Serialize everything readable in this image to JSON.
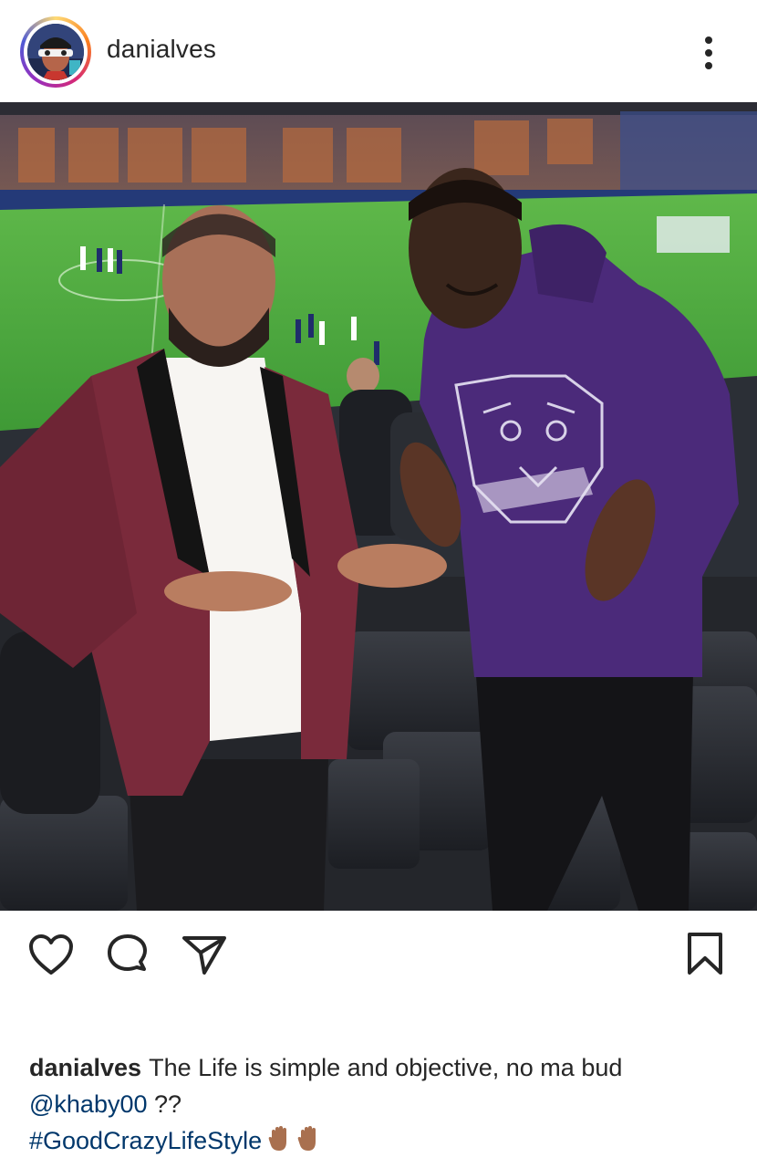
{
  "post": {
    "username": "danialves",
    "more_icon": "more-vertical-icon",
    "photo_alt": "",
    "actions": {
      "like_icon": "heart-icon",
      "comment_icon": "comment-icon",
      "share_icon": "send-icon",
      "save_icon": "bookmark-icon"
    },
    "caption": {
      "username": "danialves",
      "text": "The Life is simple and objective, no ma bud",
      "mention": "@khaby00",
      "after_mention": " ??",
      "hashtag": "#GoodCrazyLifeStyle",
      "emojis": [
        "raised-hand-emoji",
        "raised-hand-emoji"
      ]
    },
    "colors": {
      "text": "#262626",
      "link": "#00376b",
      "story_ring_start": "#feda75",
      "story_ring_end": "#962fbf"
    }
  }
}
